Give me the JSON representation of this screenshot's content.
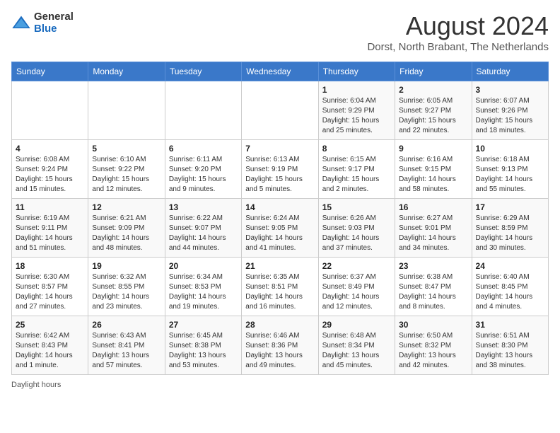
{
  "header": {
    "logo_general": "General",
    "logo_blue": "Blue",
    "month_year": "August 2024",
    "location": "Dorst, North Brabant, The Netherlands"
  },
  "days_of_week": [
    "Sunday",
    "Monday",
    "Tuesday",
    "Wednesday",
    "Thursday",
    "Friday",
    "Saturday"
  ],
  "weeks": [
    [
      {
        "day": "",
        "info": ""
      },
      {
        "day": "",
        "info": ""
      },
      {
        "day": "",
        "info": ""
      },
      {
        "day": "",
        "info": ""
      },
      {
        "day": "1",
        "info": "Sunrise: 6:04 AM\nSunset: 9:29 PM\nDaylight: 15 hours and 25 minutes."
      },
      {
        "day": "2",
        "info": "Sunrise: 6:05 AM\nSunset: 9:27 PM\nDaylight: 15 hours and 22 minutes."
      },
      {
        "day": "3",
        "info": "Sunrise: 6:07 AM\nSunset: 9:26 PM\nDaylight: 15 hours and 18 minutes."
      }
    ],
    [
      {
        "day": "4",
        "info": "Sunrise: 6:08 AM\nSunset: 9:24 PM\nDaylight: 15 hours and 15 minutes."
      },
      {
        "day": "5",
        "info": "Sunrise: 6:10 AM\nSunset: 9:22 PM\nDaylight: 15 hours and 12 minutes."
      },
      {
        "day": "6",
        "info": "Sunrise: 6:11 AM\nSunset: 9:20 PM\nDaylight: 15 hours and 9 minutes."
      },
      {
        "day": "7",
        "info": "Sunrise: 6:13 AM\nSunset: 9:19 PM\nDaylight: 15 hours and 5 minutes."
      },
      {
        "day": "8",
        "info": "Sunrise: 6:15 AM\nSunset: 9:17 PM\nDaylight: 15 hours and 2 minutes."
      },
      {
        "day": "9",
        "info": "Sunrise: 6:16 AM\nSunset: 9:15 PM\nDaylight: 14 hours and 58 minutes."
      },
      {
        "day": "10",
        "info": "Sunrise: 6:18 AM\nSunset: 9:13 PM\nDaylight: 14 hours and 55 minutes."
      }
    ],
    [
      {
        "day": "11",
        "info": "Sunrise: 6:19 AM\nSunset: 9:11 PM\nDaylight: 14 hours and 51 minutes."
      },
      {
        "day": "12",
        "info": "Sunrise: 6:21 AM\nSunset: 9:09 PM\nDaylight: 14 hours and 48 minutes."
      },
      {
        "day": "13",
        "info": "Sunrise: 6:22 AM\nSunset: 9:07 PM\nDaylight: 14 hours and 44 minutes."
      },
      {
        "day": "14",
        "info": "Sunrise: 6:24 AM\nSunset: 9:05 PM\nDaylight: 14 hours and 41 minutes."
      },
      {
        "day": "15",
        "info": "Sunrise: 6:26 AM\nSunset: 9:03 PM\nDaylight: 14 hours and 37 minutes."
      },
      {
        "day": "16",
        "info": "Sunrise: 6:27 AM\nSunset: 9:01 PM\nDaylight: 14 hours and 34 minutes."
      },
      {
        "day": "17",
        "info": "Sunrise: 6:29 AM\nSunset: 8:59 PM\nDaylight: 14 hours and 30 minutes."
      }
    ],
    [
      {
        "day": "18",
        "info": "Sunrise: 6:30 AM\nSunset: 8:57 PM\nDaylight: 14 hours and 27 minutes."
      },
      {
        "day": "19",
        "info": "Sunrise: 6:32 AM\nSunset: 8:55 PM\nDaylight: 14 hours and 23 minutes."
      },
      {
        "day": "20",
        "info": "Sunrise: 6:34 AM\nSunset: 8:53 PM\nDaylight: 14 hours and 19 minutes."
      },
      {
        "day": "21",
        "info": "Sunrise: 6:35 AM\nSunset: 8:51 PM\nDaylight: 14 hours and 16 minutes."
      },
      {
        "day": "22",
        "info": "Sunrise: 6:37 AM\nSunset: 8:49 PM\nDaylight: 14 hours and 12 minutes."
      },
      {
        "day": "23",
        "info": "Sunrise: 6:38 AM\nSunset: 8:47 PM\nDaylight: 14 hours and 8 minutes."
      },
      {
        "day": "24",
        "info": "Sunrise: 6:40 AM\nSunset: 8:45 PM\nDaylight: 14 hours and 4 minutes."
      }
    ],
    [
      {
        "day": "25",
        "info": "Sunrise: 6:42 AM\nSunset: 8:43 PM\nDaylight: 14 hours and 1 minute."
      },
      {
        "day": "26",
        "info": "Sunrise: 6:43 AM\nSunset: 8:41 PM\nDaylight: 13 hours and 57 minutes."
      },
      {
        "day": "27",
        "info": "Sunrise: 6:45 AM\nSunset: 8:38 PM\nDaylight: 13 hours and 53 minutes."
      },
      {
        "day": "28",
        "info": "Sunrise: 6:46 AM\nSunset: 8:36 PM\nDaylight: 13 hours and 49 minutes."
      },
      {
        "day": "29",
        "info": "Sunrise: 6:48 AM\nSunset: 8:34 PM\nDaylight: 13 hours and 45 minutes."
      },
      {
        "day": "30",
        "info": "Sunrise: 6:50 AM\nSunset: 8:32 PM\nDaylight: 13 hours and 42 minutes."
      },
      {
        "day": "31",
        "info": "Sunrise: 6:51 AM\nSunset: 8:30 PM\nDaylight: 13 hours and 38 minutes."
      }
    ]
  ],
  "footer": {
    "daylight_hours": "Daylight hours"
  }
}
